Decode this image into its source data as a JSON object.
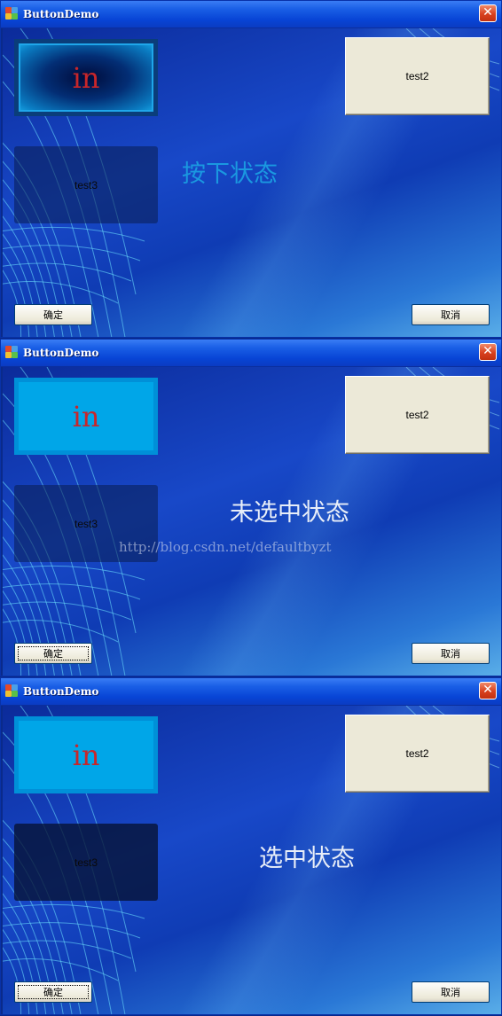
{
  "windows": [
    {
      "title": "ButtonDemo",
      "close_glyph": "✕",
      "in_button_label": "in",
      "in_button_state": "pressed",
      "test2_label": "test2",
      "test3_label": "test3",
      "state_text": "按下状态",
      "state_text_color": "#1a98e0",
      "ok_label": "确定",
      "cancel_label": "取消",
      "ok_focused": false
    },
    {
      "title": "ButtonDemo",
      "close_glyph": "✕",
      "in_button_label": "in",
      "in_button_state": "normal",
      "test2_label": "test2",
      "test3_label": "test3",
      "state_text": "未选中状态",
      "state_text_color": "#e8eef8",
      "ok_label": "确定",
      "cancel_label": "取消",
      "ok_focused": true,
      "watermark": "http://blog.csdn.net/defaultbyzt"
    },
    {
      "title": "ButtonDemo",
      "close_glyph": "✕",
      "in_button_label": "in",
      "in_button_state": "normal",
      "test2_label": "test2",
      "test3_label": "test3",
      "state_text": "选中状态",
      "state_text_color": "#e8eef8",
      "ok_label": "确定",
      "cancel_label": "取消",
      "ok_focused": true
    }
  ],
  "colors": {
    "in_button_fill": "#00a6e8",
    "in_text": "#c8262a",
    "titlebar": "#0845d6",
    "close_button": "#d8401e",
    "button_face": "#ece9d8"
  },
  "icons": {
    "app": "app-icon",
    "close": "close-icon"
  }
}
